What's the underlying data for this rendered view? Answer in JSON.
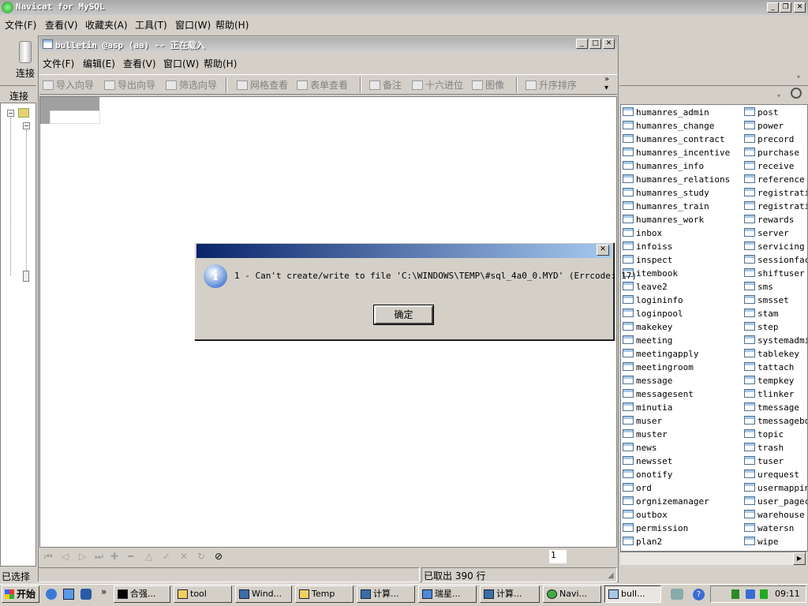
{
  "app": {
    "title": "Navicat for MySQL",
    "menu": [
      "文件(F)",
      "查看(V)",
      "收藏夹(A)",
      "工具(T)",
      "窗口(W)",
      "帮助(H)"
    ]
  },
  "left": {
    "connect_label": "连接",
    "header_label": "连接",
    "status_text": "已选择"
  },
  "child": {
    "title": "bulletin @asp (aa) -- 正在载入",
    "menu": [
      "文件(F)",
      "编辑(E)",
      "查看(V)",
      "窗口(W)",
      "帮助(H)"
    ],
    "toolbar": [
      "导入向导",
      "导出向导",
      "筛选向导",
      "网格查看",
      "表单查看",
      "备注",
      "十六进位",
      "图像",
      "升序排序"
    ],
    "page_number": "1",
    "status_rows": "已取出 390 行"
  },
  "objects": {
    "left_col": [
      "humanres_admin",
      "humanres_change",
      "humanres_contract",
      "humanres_incentive",
      "humanres_info",
      "humanres_relations",
      "humanres_study",
      "humanres_train",
      "humanres_work",
      "inbox",
      "infoiss",
      "inspect",
      "itembook",
      "leave2",
      "logininfo",
      "loginpool",
      "makekey",
      "meeting",
      "meetingapply",
      "meetingroom",
      "message",
      "messagesent",
      "minutia",
      "muser",
      "muster",
      "news",
      "newsset",
      "onotify",
      "ord",
      "orgnizemanager",
      "outbox",
      "permission",
      "plan2"
    ],
    "right_col": [
      "post",
      "power",
      "precord",
      "purchase",
      "receive",
      "reference",
      "registratio",
      "registratio",
      "rewards",
      "server",
      "servicing",
      "sessionfact",
      "shiftuser",
      "sms",
      "smsset",
      "stam",
      "step",
      "systemadmin",
      "tablekey",
      "tattach",
      "tempkey",
      "tlinker",
      "tmessage",
      "tmessagebox",
      "topic",
      "trash",
      "tuser",
      "urequest",
      "usermapping",
      "user_pageco",
      "warehouse",
      "watersn",
      "wipe"
    ]
  },
  "dialog": {
    "message": "1 - Can't create/write to file 'C:\\WINDOWS\\TEMP\\#sql_4a0_0.MYD' (Errcode: 17)",
    "ok_label": "确定"
  },
  "taskbar": {
    "start_label": "开始",
    "tasks": [
      "合强...",
      "tool",
      "Wind...",
      "Temp",
      "计算...",
      "瑞星...",
      "计算...",
      "Navi...",
      "bull..."
    ],
    "clock": "09:11"
  }
}
